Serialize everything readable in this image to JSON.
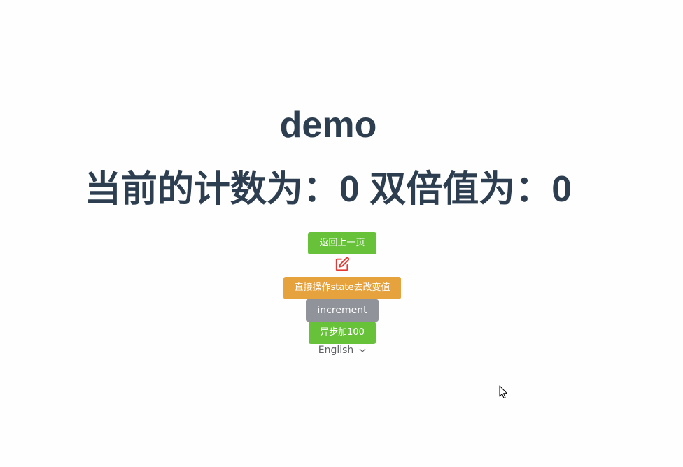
{
  "page": {
    "title": "demo",
    "counter_label": "当前的计数为：",
    "counter_value": "0",
    "double_label": " 双倍值为：",
    "double_value": "0"
  },
  "buttons": {
    "back": "返回上一页",
    "direct_state": "直接操作state去改变值",
    "increment": "increment",
    "async_add": "异步加100"
  },
  "language": {
    "selected": "English"
  },
  "icons": {
    "edit": "edit-icon",
    "chevron": "chevron-down-icon",
    "cursor": "mouse-pointer-icon"
  },
  "colors": {
    "text_dark": "#2c3e50",
    "green": "#67c23a",
    "orange": "#e6a23c",
    "grey": "#909399",
    "icon_red": "#e53935"
  }
}
